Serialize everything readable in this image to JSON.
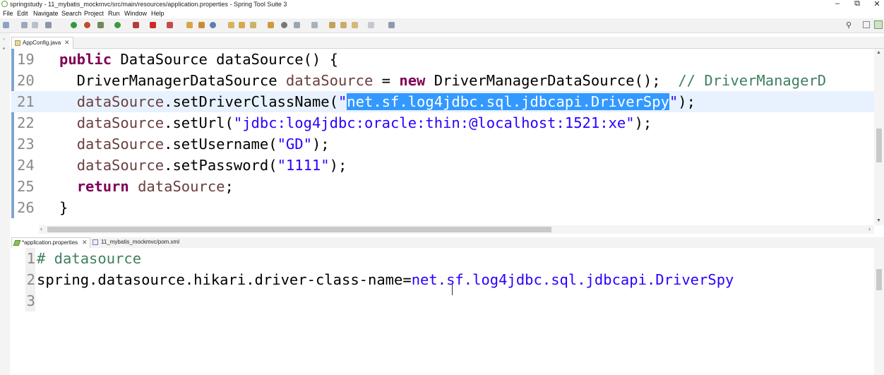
{
  "window": {
    "title": "springstudy - 11_mybatis_mockmvc/src/main/resources/application.properties - Spring Tool Suite 3",
    "minimize": "–",
    "maximize": "⧉",
    "close": "✕"
  },
  "menu": [
    "File",
    "Edit",
    "Navigate",
    "Search",
    "Project",
    "Run",
    "Window",
    "Help"
  ],
  "top_editor": {
    "tab_label": "AppConfig.java",
    "lines": [
      {
        "num": "19",
        "segments": [
          {
            "t": "public",
            "c": "kw"
          },
          {
            "t": " DataSource dataSource() {",
            "c": ""
          }
        ]
      },
      {
        "num": "20",
        "segments": [
          {
            "t": "  DriverManagerDataSource ",
            "c": ""
          },
          {
            "t": "dataSource",
            "c": "var"
          },
          {
            "t": " = ",
            "c": ""
          },
          {
            "t": "new",
            "c": "kw"
          },
          {
            "t": " DriverManagerDataSource();  ",
            "c": ""
          },
          {
            "t": "// DriverManagerD",
            "c": "cmt"
          }
        ]
      },
      {
        "num": "21",
        "segments": [
          {
            "t": "  ",
            "c": ""
          },
          {
            "t": "dataSource",
            "c": "var"
          },
          {
            "t": ".setDriverClassName(",
            "c": ""
          },
          {
            "t": "\"",
            "c": "str"
          },
          {
            "t": "net.sf.log4jdbc.sql.jdbcapi.DriverSpy",
            "c": "sel"
          },
          {
            "t": "\"",
            "c": "str"
          },
          {
            "t": ");",
            "c": ""
          }
        ]
      },
      {
        "num": "22",
        "segments": [
          {
            "t": "  ",
            "c": ""
          },
          {
            "t": "dataSource",
            "c": "var"
          },
          {
            "t": ".setUrl(",
            "c": ""
          },
          {
            "t": "\"jdbc:log4jdbc:oracle:thin:@localhost:1521:xe\"",
            "c": "str"
          },
          {
            "t": ");",
            "c": ""
          }
        ]
      },
      {
        "num": "23",
        "segments": [
          {
            "t": "  ",
            "c": ""
          },
          {
            "t": "dataSource",
            "c": "var"
          },
          {
            "t": ".setUsername(",
            "c": ""
          },
          {
            "t": "\"GD\"",
            "c": "str"
          },
          {
            "t": ");",
            "c": ""
          }
        ]
      },
      {
        "num": "24",
        "segments": [
          {
            "t": "  ",
            "c": ""
          },
          {
            "t": "dataSource",
            "c": "var"
          },
          {
            "t": ".setPassword(",
            "c": ""
          },
          {
            "t": "\"1111\"",
            "c": "str"
          },
          {
            "t": ");",
            "c": ""
          }
        ]
      },
      {
        "num": "25",
        "segments": [
          {
            "t": "  ",
            "c": ""
          },
          {
            "t": "return",
            "c": "kw"
          },
          {
            "t": " ",
            "c": ""
          },
          {
            "t": "dataSource",
            "c": "var"
          },
          {
            "t": ";",
            "c": ""
          }
        ]
      },
      {
        "num": "26",
        "segments": [
          {
            "t": "}",
            "c": ""
          }
        ]
      }
    ]
  },
  "bottom_tabs": [
    {
      "label": "*application.properties",
      "close": "✕"
    },
    {
      "label": "11_mybatis_mockmvc/pom.xml"
    }
  ],
  "bottom_editor": {
    "lines": [
      {
        "num": "1",
        "segments": [
          {
            "t": "# datasource",
            "c": "cmt2"
          }
        ]
      },
      {
        "num": "2",
        "segments": [
          {
            "t": "spring.datasource.hikari.driver-class-name=",
            "c": "key"
          },
          {
            "t": "net.sf.log4jdbc.sql.jdbcapi.DriverSpy",
            "c": "val"
          }
        ]
      },
      {
        "num": "3",
        "segments": []
      }
    ]
  },
  "colors": {
    "keyword": "#7f0055",
    "local_variable": "#6a3e3e",
    "string": "#2a00ff",
    "comment": "#3f7f5f",
    "selection": "#3399ff",
    "current_line": "#e8f2fe"
  },
  "icons": [
    "app-icon",
    "search-icon",
    "perspective-icon"
  ]
}
